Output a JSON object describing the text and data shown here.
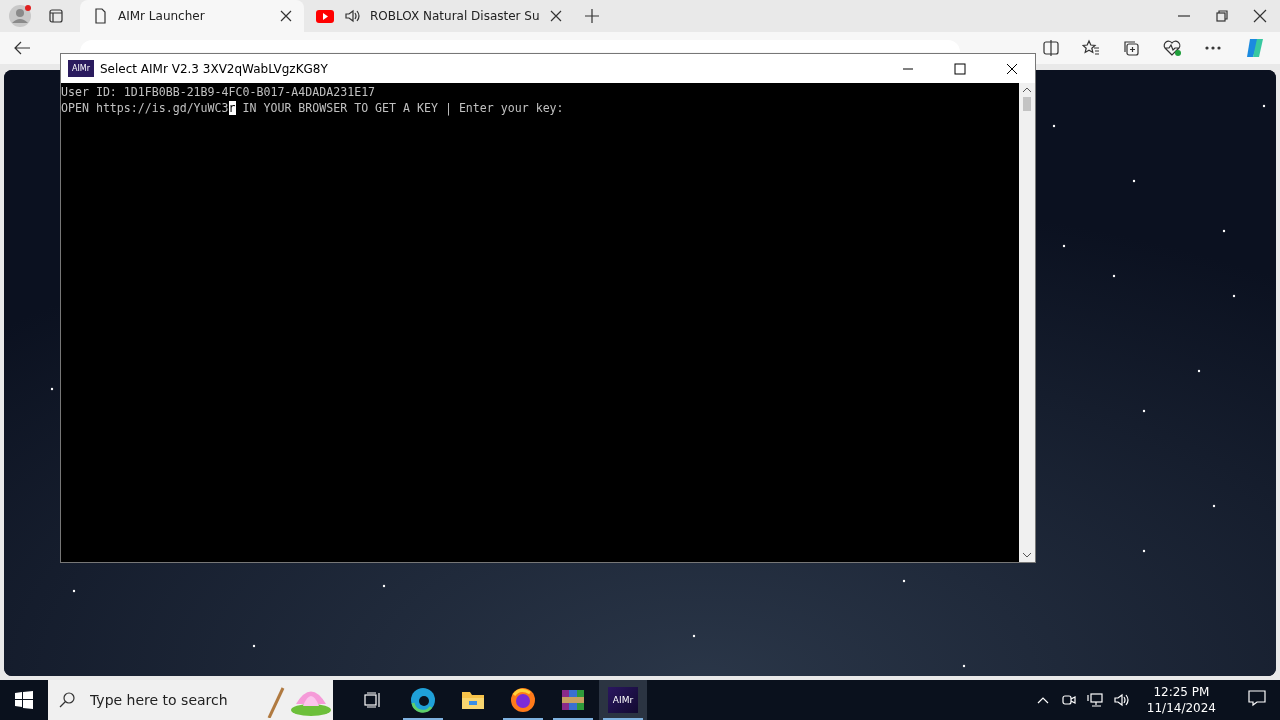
{
  "browser": {
    "tabs": [
      {
        "title": "AIMr Launcher",
        "kind": "page",
        "selected": true
      },
      {
        "title": "ROBLOX Natural Disaster Su",
        "kind": "video",
        "selected": false
      }
    ]
  },
  "console": {
    "title": "Select AIMr V2.3 3XV2qWabLVgzKG8Y",
    "app_icon": "AIMr",
    "lines": [
      {
        "before": "User ID: 1D1FB0BB-21B9-4FC0-B017-A4DADA231E17"
      },
      {
        "before": "OPEN https://is.gd/YuWC3",
        "cursor": "r",
        "after": " IN YOUR BROWSER TO GET A KEY | Enter your key:"
      }
    ]
  },
  "taskbar": {
    "search": {
      "placeholder": "Type here to search"
    },
    "apps": [
      {
        "kind": "taskview",
        "running": false,
        "selected": false
      },
      {
        "kind": "edge",
        "running": true,
        "selected": false
      },
      {
        "kind": "explorer",
        "running": false,
        "selected": false
      },
      {
        "kind": "firefox",
        "running": true,
        "selected": false
      },
      {
        "kind": "winrar",
        "running": true,
        "selected": false
      },
      {
        "kind": "aimr",
        "label": "AIMr",
        "running": true,
        "selected": true
      }
    ],
    "time": "12:25 PM",
    "date": "11/14/2024"
  }
}
